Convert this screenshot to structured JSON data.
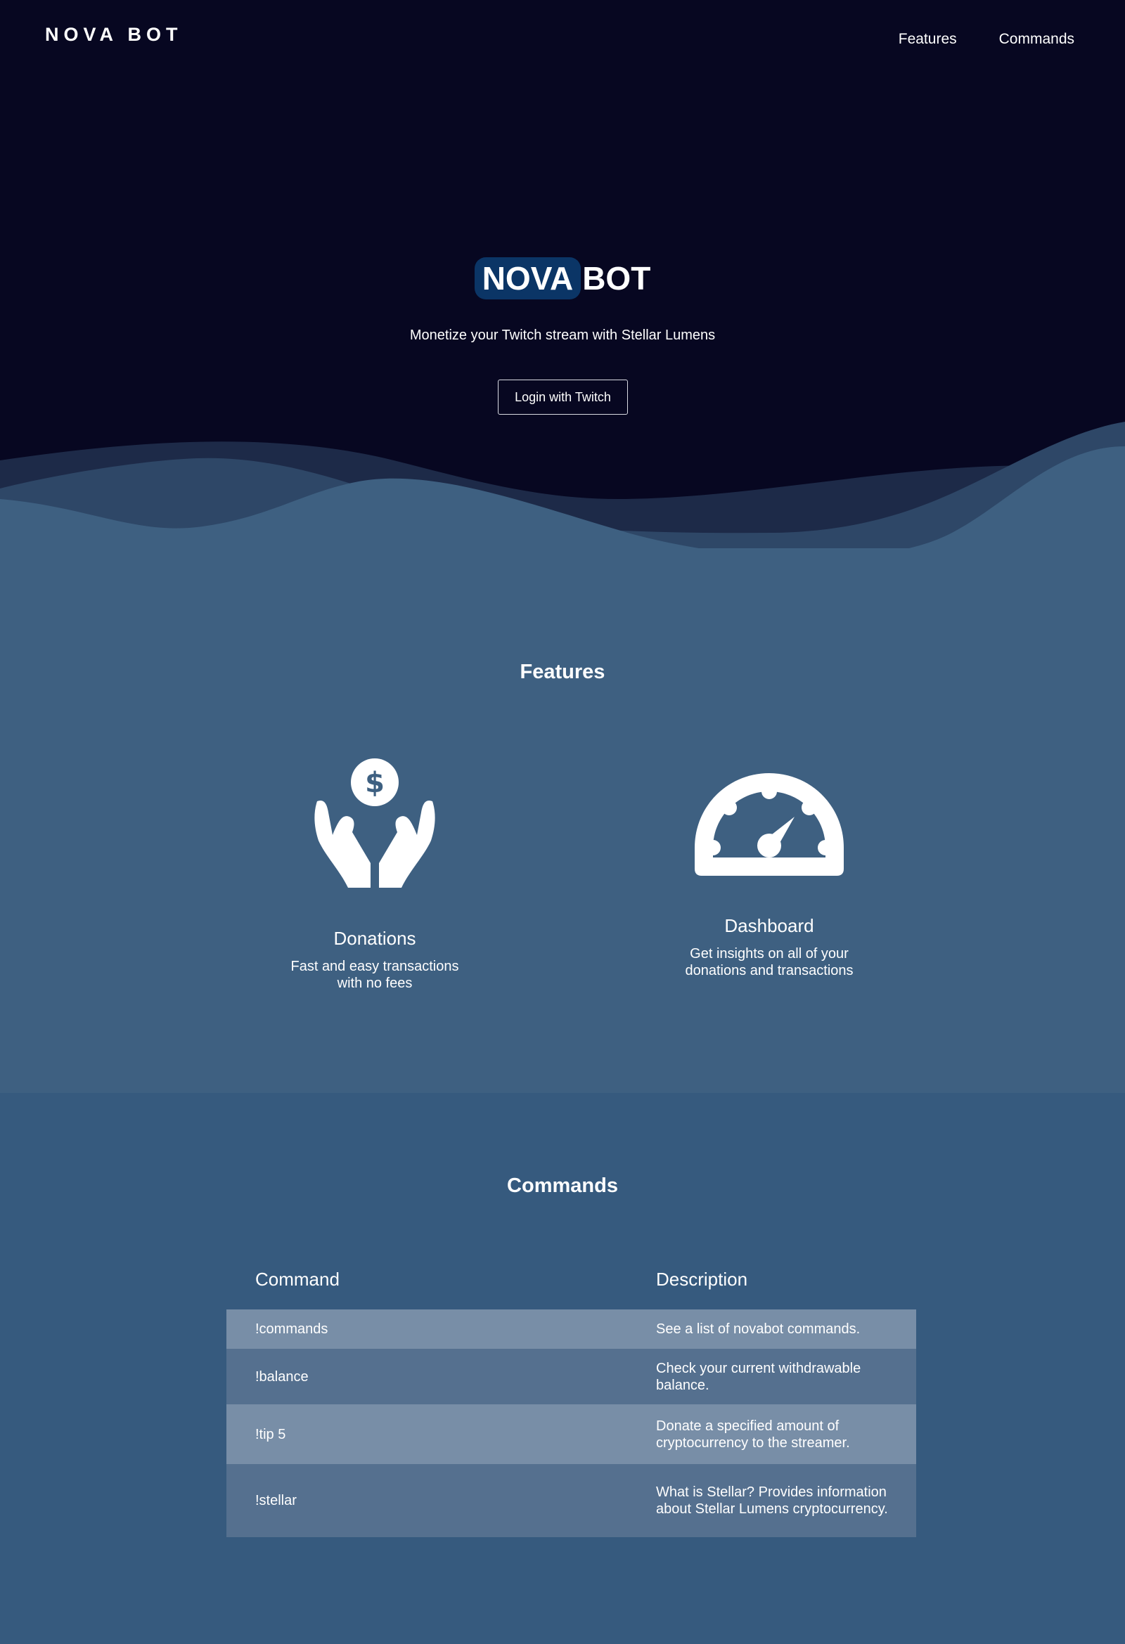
{
  "header": {
    "brand": "NOVA BOT",
    "nav": [
      {
        "label": "Features"
      },
      {
        "label": "Commands"
      }
    ]
  },
  "hero": {
    "title_highlight": "NOVA",
    "title_rest": "BOT",
    "tagline": "Monetize your Twitch stream with Stellar Lumens",
    "login_button": "Login with Twitch"
  },
  "features": {
    "title": "Features",
    "items": [
      {
        "icon": "hands-dollar-icon",
        "title": "Donations",
        "description": "Fast and easy transactions with no fees"
      },
      {
        "icon": "speedometer-icon",
        "title": "Dashboard",
        "description": "Get insights on all of your donations and transactions"
      }
    ]
  },
  "commands": {
    "title": "Commands",
    "headers": [
      "Command",
      "Description"
    ],
    "rows": [
      {
        "command": "!commands",
        "description": "See a list of novabot commands."
      },
      {
        "command": "!balance",
        "description": "Check your current withdrawable balance."
      },
      {
        "command": "!tip 5",
        "description": "Donate a specified amount of cryptocurrency to the streamer."
      },
      {
        "command": "!stellar",
        "description": "What is Stellar? Provides information about Stellar Lumens cryptocurrency."
      }
    ]
  },
  "colors": {
    "hero_bg": "#070721",
    "highlight": "#0b3566",
    "features_bg": "#3e6081",
    "commands_bg": "#365a7e",
    "row_light": "#788ea7",
    "row_dark": "#55708f"
  }
}
